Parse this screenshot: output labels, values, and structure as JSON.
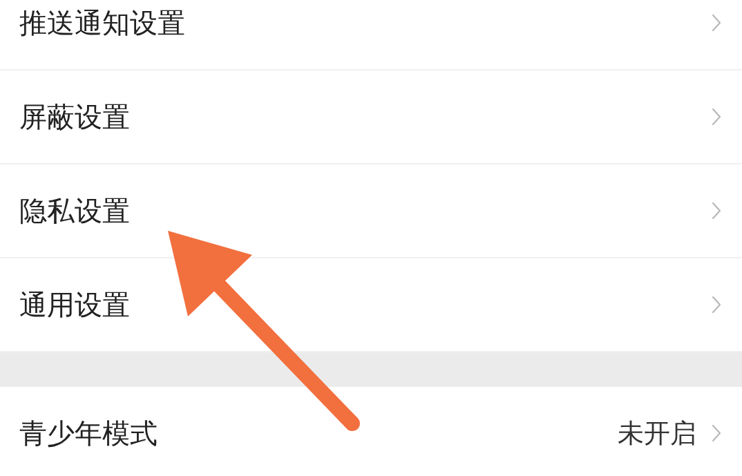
{
  "settings_groups": [
    {
      "items": [
        {
          "label": "推送通知设置"
        },
        {
          "label": "屏蔽设置"
        },
        {
          "label": "隐私设置"
        },
        {
          "label": "通用设置"
        }
      ]
    },
    {
      "items": [
        {
          "label": "青少年模式",
          "value": "未开启"
        }
      ]
    }
  ]
}
